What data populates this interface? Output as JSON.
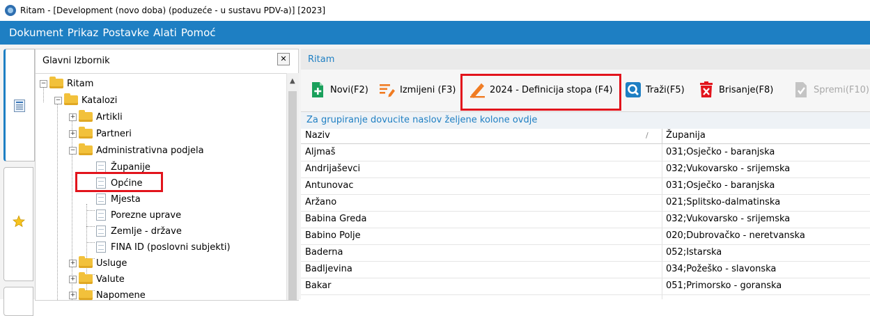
{
  "window": {
    "title": "Ritam - [Development (novo doba) (poduzeće - u sustavu PDV-a)] [2023]"
  },
  "menu": [
    "Dokument",
    "Prikaz",
    "Postavke",
    "Alati",
    "Pomoć"
  ],
  "left_panel": {
    "title": "Glavni Izbornik",
    "close_label": "✕",
    "tree": [
      {
        "label": "Ritam",
        "type": "folder",
        "expander": "⊟"
      },
      {
        "label": "Katalozi",
        "type": "folder",
        "expander": "⊟"
      },
      {
        "label": "Artikli",
        "type": "folder",
        "expander": "⊞"
      },
      {
        "label": "Partneri",
        "type": "folder",
        "expander": "⊞"
      },
      {
        "label": "Administrativna podjela",
        "type": "folder",
        "expander": "⊟"
      },
      {
        "label": "Županije",
        "type": "doc"
      },
      {
        "label": "Općine",
        "type": "doc",
        "highlighted": true
      },
      {
        "label": "Mjesta",
        "type": "doc"
      },
      {
        "label": "Porezne uprave",
        "type": "doc"
      },
      {
        "label": "Zemlje - države",
        "type": "doc"
      },
      {
        "label": "FINA ID (poslovni subjekti)",
        "type": "doc"
      },
      {
        "label": "Usluge",
        "type": "folder",
        "expander": "⊞"
      },
      {
        "label": "Valute",
        "type": "folder",
        "expander": "⊞"
      },
      {
        "label": "Napomene",
        "type": "folder",
        "expander": "⊞"
      }
    ]
  },
  "right_panel": {
    "title": "Ritam",
    "toolbar": [
      {
        "label": "Novi(F2)",
        "icon": "new-icon",
        "color": "#1aa05c"
      },
      {
        "label": "Izmijeni (F3)",
        "icon": "edit-icon",
        "color": "#f07b22"
      },
      {
        "label": "2024 - Definicija stopa (F4)",
        "icon": "pencil-icon",
        "color": "#f07b22",
        "highlighted": true
      },
      {
        "label": "Traži(F5)",
        "icon": "search-icon",
        "color": "#1e7fc3"
      },
      {
        "label": "Brisanje(F8)",
        "icon": "delete-icon",
        "color": "#e2141c"
      },
      {
        "label": "Spremi(F10)",
        "icon": "save-icon",
        "color": "#b8b8b8",
        "disabled": true
      }
    ],
    "group_hint": "Za grupiranje dovucite naslov željene kolone ovdje",
    "columns": [
      "Naziv",
      "Županija"
    ],
    "sort_indicator": "/",
    "rows": [
      [
        "Aljmaš",
        "031;Osječko - baranjska"
      ],
      [
        "Andrijaševci",
        "032;Vukovarsko - srijemska"
      ],
      [
        "Antunovac",
        "031;Osječko - baranjska"
      ],
      [
        "Aržano",
        "021;Splitsko-dalmatinska"
      ],
      [
        "Babina Greda",
        "032;Vukovarsko - srijemska"
      ],
      [
        "Babino Polje",
        "020;Dubrovačko - neretvanska"
      ],
      [
        "Baderna",
        "052;Istarska"
      ],
      [
        "Badljevina",
        "034;Požeško - slavonska"
      ],
      [
        "Bakar",
        "051;Primorsko - goranska"
      ]
    ]
  },
  "colors": {
    "accent": "#1e7fc3",
    "highlight": "#e2141c"
  }
}
